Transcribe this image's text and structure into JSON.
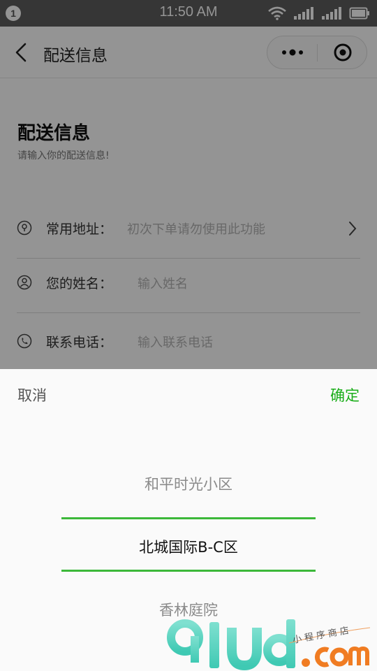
{
  "status_bar": {
    "notification_count": "1",
    "time": "11:50 AM",
    "icons": [
      "wifi-icon",
      "signal-icon",
      "signal-icon",
      "battery-icon"
    ]
  },
  "nav": {
    "title": "配送信息",
    "back_icon": "chevron-left-icon",
    "menu_icon": "more-dots-icon",
    "close_icon": "target-circle-icon"
  },
  "page": {
    "title": "配送信息",
    "subtitle": "请输入你的配送信息!",
    "fields": [
      {
        "icon": "location-pin-icon",
        "label": "常用地址：",
        "placeholder": "初次下单请勿使用此功能"
      },
      {
        "icon": "user-icon",
        "label": "您的姓名：",
        "placeholder": "输入姓名"
      },
      {
        "icon": "phone-icon",
        "label": "联系电话：",
        "placeholder": "输入联系电话"
      }
    ]
  },
  "picker": {
    "cancel_label": "取消",
    "confirm_label": "确定",
    "options": [
      "和平时光小区",
      "北城国际B-C区",
      "香林庭院"
    ],
    "selected": "北城国际B-C区"
  },
  "colors": {
    "accent": "#1aad19",
    "selection_line": "#3cb83a",
    "status_bar": "#5d5d5d"
  }
}
